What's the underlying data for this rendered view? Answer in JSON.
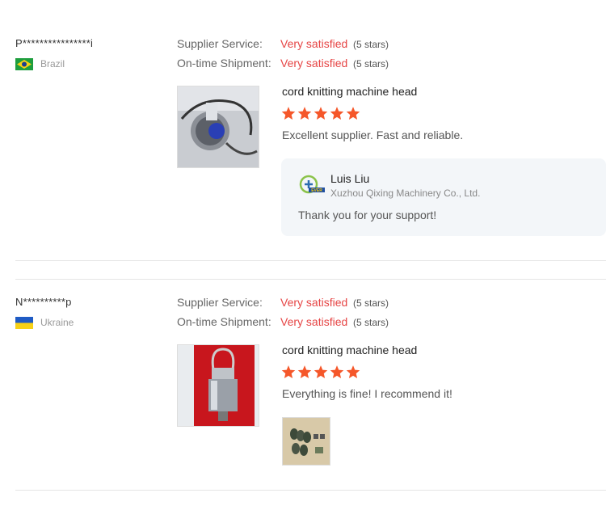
{
  "labels": {
    "supplier_service": "Supplier Service:",
    "ontime_shipment": "On-time Shipment:"
  },
  "reviews": [
    {
      "buyer": "P****************i",
      "country": "Brazil",
      "flag_icon": "brazil-flag-icon",
      "supplier_service": "Very satisfied",
      "supplier_service_stars": "(5 stars)",
      "ontime_shipment": "Very satisfied",
      "ontime_shipment_stars": "(5 stars)",
      "product_title": "cord knitting machine head",
      "rating": 5,
      "comment": "Excellent supplier. Fast and reliable.",
      "reply": {
        "name": "Luis Liu",
        "company": "Xuzhou Qixing Machinery Co., Ltd.",
        "text": "Thank you for your support!"
      }
    },
    {
      "buyer": "N**********p",
      "country": "Ukraine",
      "flag_icon": "ukraine-flag-icon",
      "supplier_service": "Very satisfied",
      "supplier_service_stars": "(5 stars)",
      "ontime_shipment": "Very satisfied",
      "ontime_shipment_stars": "(5 stars)",
      "product_title": "cord knitting machine head",
      "rating": 5,
      "comment": "Everything is fine! I recommend it!"
    }
  ],
  "colors": {
    "accent_red": "#e64545",
    "star": "#f5572a",
    "reply_bg": "#f3f6f9"
  }
}
